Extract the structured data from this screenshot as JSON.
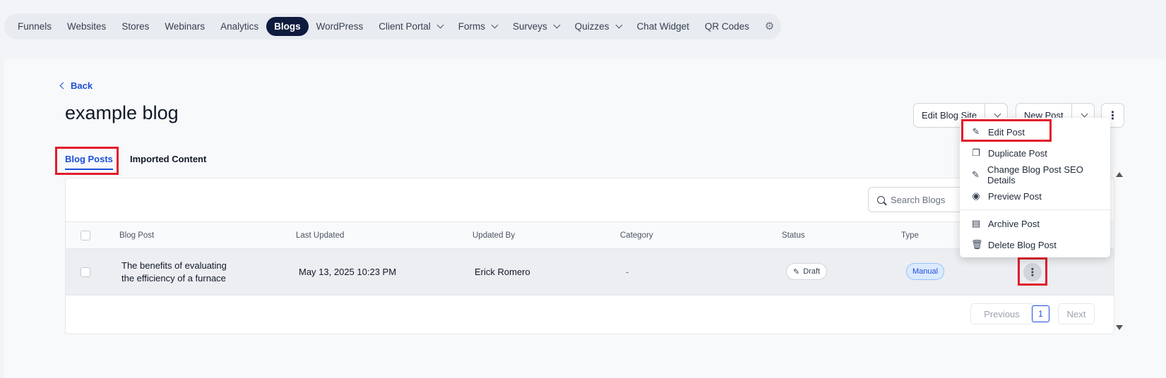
{
  "topnav": {
    "items": [
      {
        "label": "Funnels"
      },
      {
        "label": "Websites"
      },
      {
        "label": "Stores"
      },
      {
        "label": "Webinars"
      },
      {
        "label": "Analytics"
      },
      {
        "label": "Blogs",
        "active": true
      },
      {
        "label": "WordPress"
      },
      {
        "label": "Client Portal",
        "dropdown": true
      },
      {
        "label": "Forms",
        "dropdown": true
      },
      {
        "label": "Surveys",
        "dropdown": true
      },
      {
        "label": "Quizzes",
        "dropdown": true
      },
      {
        "label": "Chat Widget"
      },
      {
        "label": "QR Codes"
      }
    ],
    "settings_icon": "gear-icon"
  },
  "page": {
    "back_label": "Back",
    "title": "example blog",
    "edit_blog_site_label": "Edit Blog Site",
    "new_post_label": "New Post"
  },
  "tabs": [
    {
      "label": "Blog Posts",
      "active": true
    },
    {
      "label": "Imported Content"
    }
  ],
  "search": {
    "placeholder": "Search Blogs"
  },
  "table": {
    "headers": [
      "Blog Post",
      "Last Updated",
      "Updated By",
      "Category",
      "Status",
      "Type"
    ],
    "rows": [
      {
        "title_line1": "The benefits of evaluating",
        "title_line2": "the efficiency of a furnace",
        "last_updated": "May 13, 2025 10:23 PM",
        "updated_by": "Erick Romero",
        "category": "-",
        "status": "Draft",
        "type": "Manual"
      }
    ]
  },
  "pagination": {
    "previous": "Previous",
    "current": "1",
    "next": "Next"
  },
  "menu": {
    "items": [
      {
        "label": "Edit Post",
        "icon": "pencil-icon"
      },
      {
        "label": "Duplicate Post",
        "icon": "copy-icon"
      },
      {
        "label": "Change Blog Post SEO Details",
        "icon": "pencil-icon"
      },
      {
        "label": "Preview Post",
        "icon": "eye-icon"
      },
      {
        "label": "Archive Post",
        "icon": "archive-icon"
      },
      {
        "label": "Delete Blog Post",
        "icon": "trash-icon"
      }
    ]
  },
  "colors": {
    "accent": "#1d4ed8",
    "nav_active": "#0f1b3d",
    "highlight": "#e11d2b"
  }
}
